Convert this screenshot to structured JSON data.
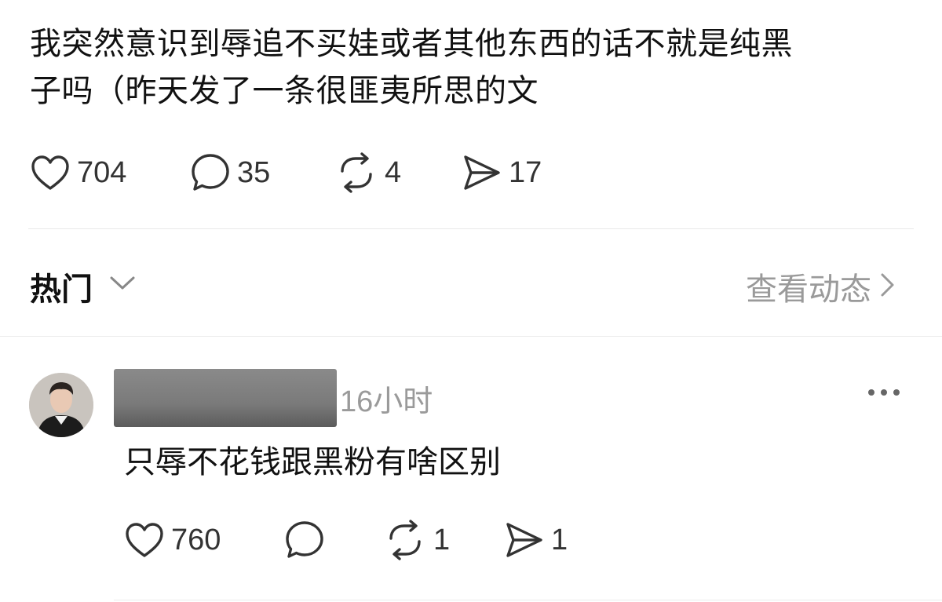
{
  "post": {
    "text_lines": [
      "我突然意识到辱追不买娃或者其他东西的话不就是纯黑",
      "子吗（昨天发了一条很匪夷所思的文"
    ],
    "likes": "704",
    "comments": "35",
    "reposts": "4",
    "shares": "17"
  },
  "feed": {
    "sort_label": "热门",
    "view_more_label": "查看动态"
  },
  "comment": {
    "time": "16小时",
    "text": "只辱不花钱跟黑粉有啥区别",
    "likes": "760",
    "reposts": "1",
    "shares": "1"
  },
  "icons": {
    "like": "heart-outline-icon",
    "comment": "speech-bubble-icon",
    "repost": "repost-arrows-icon",
    "share": "paper-plane-icon",
    "more": "more-dots-icon"
  },
  "colors": {
    "text_primary": "#111111",
    "text_secondary": "#9a9a9a",
    "icon": "#333333",
    "divider": "#e8e8e8"
  }
}
